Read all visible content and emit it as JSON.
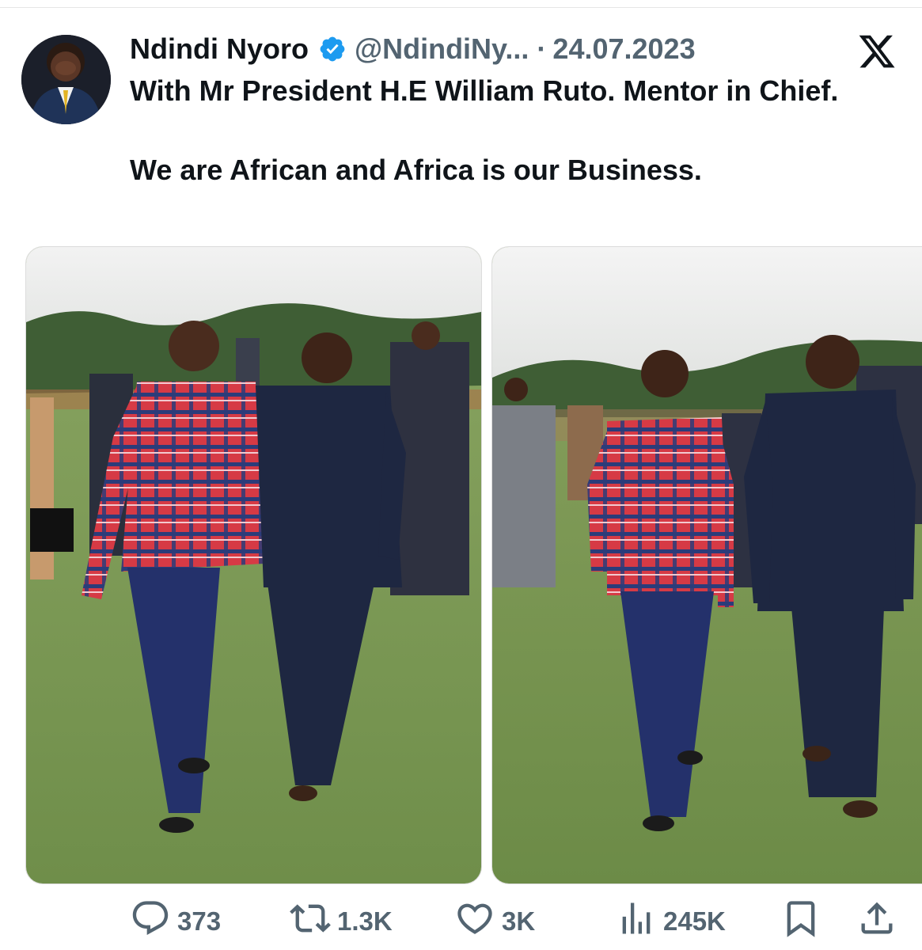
{
  "tweet": {
    "display_name": "Ndindi Nyoro",
    "verified": true,
    "handle": "@NdindiNy...",
    "separator": "·",
    "date": "24.07.2023",
    "text_line_1": "With Mr President H.E William Ruto. Mentor in Chief.",
    "text_line_2": "We are African and Africa is our Business."
  },
  "platform_icon": "x-logo-icon",
  "icons": {
    "avatar": "profile-photo",
    "verified": "verified-badge-icon",
    "replies": "speech-bubble-icon",
    "reposts": "repost-icon",
    "likes": "heart-icon",
    "views": "bar-chart-icon",
    "bookmark": "bookmark-icon",
    "share": "share-icon"
  },
  "metrics": {
    "replies": "373",
    "reposts": "1.3K",
    "likes": "3K",
    "views": "245K"
  },
  "colors": {
    "verified_blue": "#1d9bf0",
    "text_primary": "#0f1419",
    "text_secondary": "#536471"
  }
}
